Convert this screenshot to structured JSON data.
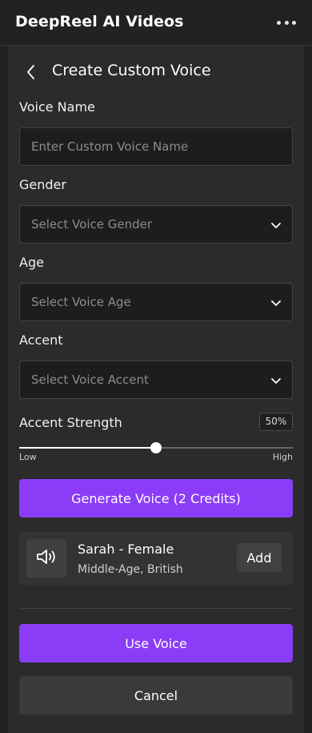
{
  "app": {
    "title": "DeepReel AI Videos"
  },
  "page": {
    "title": "Create Custom Voice"
  },
  "fields": {
    "voice_name": {
      "label": "Voice Name",
      "placeholder": "Enter Custom Voice Name",
      "value": ""
    },
    "gender": {
      "label": "Gender",
      "placeholder": "Select Voice Gender"
    },
    "age": {
      "label": "Age",
      "placeholder": "Select Voice Age"
    },
    "accent": {
      "label": "Accent",
      "placeholder": "Select Voice Accent"
    }
  },
  "accent_strength": {
    "label": "Accent Strength",
    "value_text": "50%",
    "value": 0.5,
    "low_label": "Low",
    "high_label": "High"
  },
  "buttons": {
    "generate": "Generate Voice (2 Credits)",
    "use_voice": "Use Voice",
    "cancel": "Cancel"
  },
  "generated_voice": {
    "name": "Sarah - Female",
    "description": "Middle-Age, British",
    "add_label": "Add",
    "icon": "speaker-icon"
  },
  "icons": {
    "more": "more-horizontal-icon",
    "back": "chevron-left-icon",
    "dropdown": "chevron-down-icon"
  },
  "colors": {
    "accent": "#8b3cf7",
    "background": "#222222",
    "panel": "#2b2b2b"
  }
}
